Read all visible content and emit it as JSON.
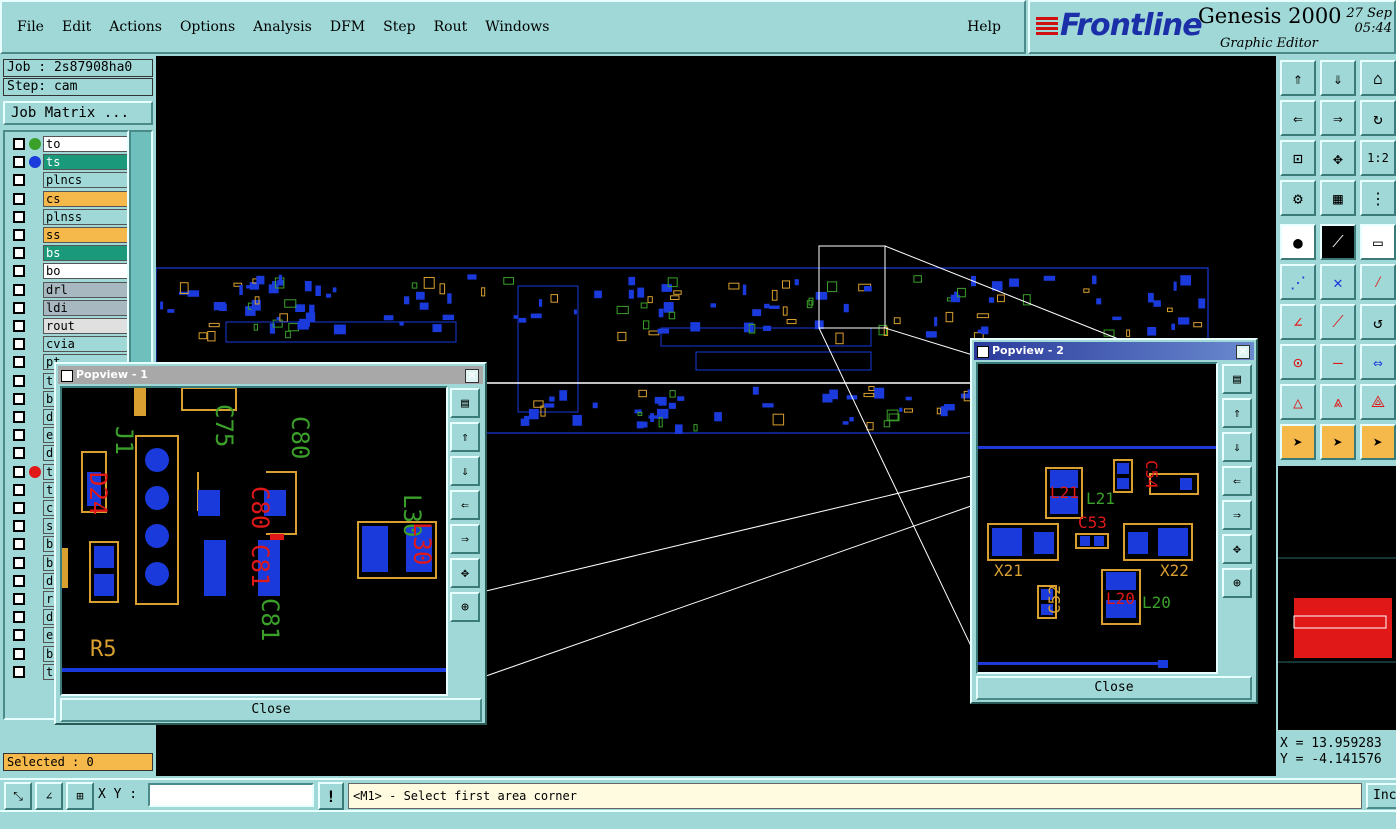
{
  "menu": {
    "items": [
      "File",
      "Edit",
      "Actions",
      "Options",
      "Analysis",
      "DFM",
      "Step",
      "Rout",
      "Windows"
    ],
    "help": "Help"
  },
  "brand": {
    "logo": "Frontline",
    "product": "Genesis 2000",
    "subtitle": "Graphic Editor",
    "date": "27 Sep",
    "time": "05:44"
  },
  "job": {
    "job_label": "Job : 2s87908ha0",
    "step_label": "Step: cam",
    "matrix_button": "Job Matrix ..."
  },
  "layers": [
    {
      "name": "to",
      "color": "#ffffff",
      "dot": "#3aa02a"
    },
    {
      "name": "ts",
      "color": "#1a9a7a",
      "dot": "#1a3adc"
    },
    {
      "name": "plncs",
      "color": "#9fd8d6",
      "dot": ""
    },
    {
      "name": "cs",
      "color": "#f5b84a",
      "dot": ""
    },
    {
      "name": "plnss",
      "color": "#9fd8d6",
      "dot": ""
    },
    {
      "name": "ss",
      "color": "#f5b84a",
      "dot": ""
    },
    {
      "name": "bs",
      "color": "#1a9a7a",
      "dot": ""
    },
    {
      "name": "bo",
      "color": "#ffffff",
      "dot": ""
    },
    {
      "name": "drl",
      "color": "#a8b8c0",
      "dot": ""
    },
    {
      "name": "ldi",
      "color": "#a8b8c0",
      "dot": ""
    },
    {
      "name": "rout",
      "color": "#e0e0e0",
      "dot": ""
    },
    {
      "name": "cvia",
      "color": "#9fd8d6",
      "dot": ""
    },
    {
      "name": "pt",
      "color": "#9fd8d6",
      "dot": ""
    },
    {
      "name": "t",
      "color": "#9fd8d6",
      "dot": ""
    },
    {
      "name": "b",
      "color": "#9fd8d6",
      "dot": ""
    },
    {
      "name": "d",
      "color": "#9fd8d6",
      "dot": ""
    },
    {
      "name": "e",
      "color": "#9fd8d6",
      "dot": ""
    },
    {
      "name": "d",
      "color": "#9fd8d6",
      "dot": ""
    },
    {
      "name": "t",
      "color": "#9fd8d6",
      "dot": "#e01818"
    },
    {
      "name": "t",
      "color": "#9fd8d6",
      "dot": ""
    },
    {
      "name": "c",
      "color": "#9fd8d6",
      "dot": ""
    },
    {
      "name": "s",
      "color": "#9fd8d6",
      "dot": ""
    },
    {
      "name": "b",
      "color": "#9fd8d6",
      "dot": ""
    },
    {
      "name": "b",
      "color": "#9fd8d6",
      "dot": ""
    },
    {
      "name": "d",
      "color": "#9fd8d6",
      "dot": ""
    },
    {
      "name": "r",
      "color": "#9fd8d6",
      "dot": ""
    },
    {
      "name": "d",
      "color": "#9fd8d6",
      "dot": ""
    },
    {
      "name": "e",
      "color": "#9fd8d6",
      "dot": ""
    },
    {
      "name": "b",
      "color": "#9fd8d6",
      "dot": ""
    },
    {
      "name": "t",
      "color": "#9fd8d6",
      "dot": ""
    }
  ],
  "selected": "Selected : 0",
  "popview1": {
    "title": "Popview - 1",
    "close": "Close",
    "labels": [
      "J1",
      "C75",
      "C80",
      "C80",
      "D24",
      "L30",
      "L30",
      "C81",
      "C81",
      "R5"
    ]
  },
  "popview2": {
    "title": "Popview - 2",
    "close": "Close",
    "labels": [
      "L21",
      "L21",
      "C53",
      "C54",
      "X21",
      "X22",
      "C52",
      "L20",
      "L20"
    ]
  },
  "coords": {
    "x": "X = 13.959283",
    "y": "Y = -4.141576"
  },
  "bottom": {
    "xy_label": "X Y :",
    "xy_value": "",
    "excl": "!",
    "message": "<M1> - Select first area corner",
    "inc": "Inc"
  },
  "colors": {
    "panel": "#9fd8d6",
    "canvas": "#000000",
    "pad": "#1a3adc",
    "silk_orange": "#d8a030",
    "silk_red": "#e01818",
    "silk_green": "#3aa02a",
    "highlight": "#f5b84a"
  }
}
